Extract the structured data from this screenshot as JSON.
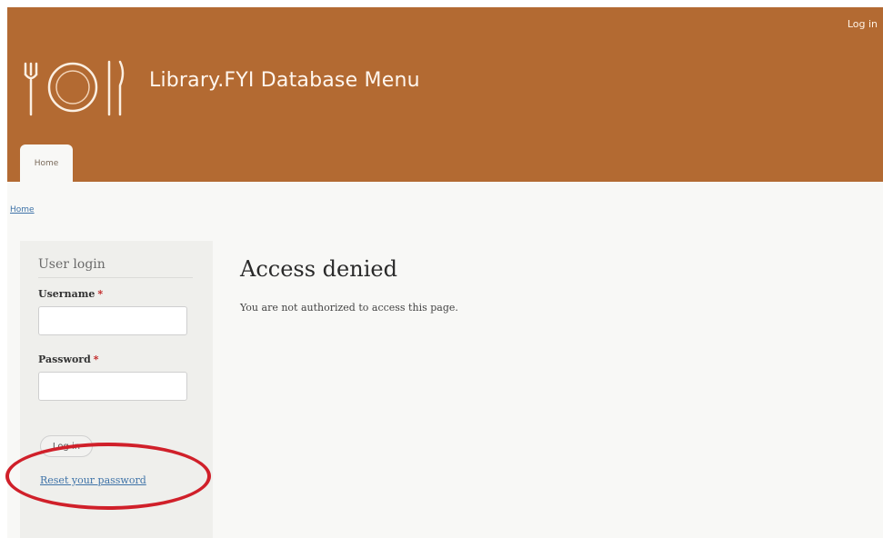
{
  "header": {
    "top_login_label": "Log in",
    "site_name": "Library.FYI Database Menu",
    "logo_icon": "plate-fork-knife-icon",
    "background_color": "#b36a32"
  },
  "nav": {
    "tabs": [
      {
        "label": "Home"
      }
    ]
  },
  "breadcrumb": {
    "items": [
      "Home"
    ]
  },
  "sidebar": {
    "block_title": "User login",
    "username_label": "Username",
    "username_value": "",
    "password_label": "Password",
    "password_value": "",
    "required_marker": "*",
    "login_button_label": "Log in",
    "reset_password_link": "Reset your password"
  },
  "main": {
    "title": "Access denied",
    "message": "You are not authorized to access this page."
  },
  "annotation": {
    "highlight_color": "#d0202a"
  }
}
